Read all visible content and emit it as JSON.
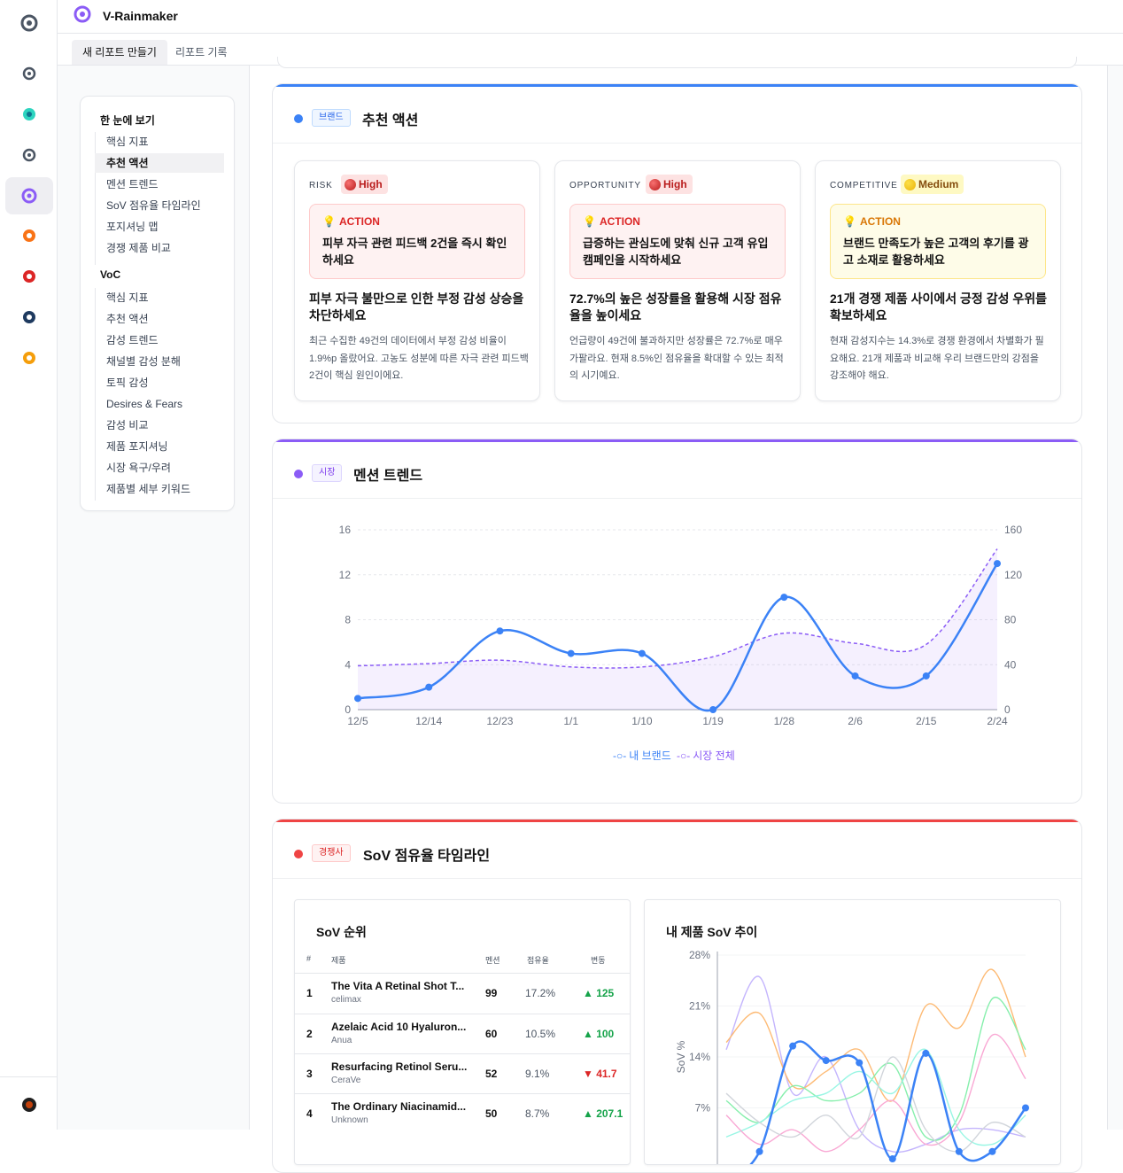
{
  "app": {
    "title": "V-Rainmaker"
  },
  "tabs": [
    {
      "label": "새 리포트 만들기"
    },
    {
      "label": "리포트 기록"
    }
  ],
  "rail": {
    "icons": [
      "rainmaker-gray-logo",
      "rainmaker-gray-logo",
      "teal-swirl-logo",
      "rainmaker-gray-logo",
      "rainmaker-purple-logo",
      "orange-heart-logo",
      "red-heart-logo",
      "navy-ring-logo",
      "orange-ring-logo"
    ],
    "avatar": "user-avatar"
  },
  "toc": {
    "group1": {
      "title": "한 눈에 보기",
      "items": [
        "핵심 지표",
        "추천 액션",
        "멘션 트렌드",
        "SoV 점유율 타임라인",
        "포지셔닝 맵",
        "경쟁 제품 비교"
      ]
    },
    "group2": {
      "title": "VoC",
      "items": [
        "핵심 지표",
        "추천 액션",
        "감성 트렌드",
        "채널별 감성 분해",
        "토픽 감성",
        "Desires & Fears",
        "감성 비교",
        "제품 포지셔닝",
        "시장 욕구/우려",
        "제품별 세부 키워드"
      ]
    },
    "selected": "추천 액션"
  },
  "actions_card": {
    "tag": "브랜드",
    "title": "추천 액션",
    "accent": "#3b82f6",
    "items": [
      {
        "type": "RISK",
        "level": "High",
        "action_label": "ACTION",
        "action": "피부 자극 관련 피드백 2건을 즉시 확인하세요",
        "headline": "피부 자극 불만으로 인한 부정 감성 상승을 차단하세요",
        "body": "최근 수집한 49건의 데이터에서 부정 감성 비율이 1.9%p 올랐어요. 고농도 성분에 따른 자극 관련 피드백 2건이 핵심 원인이에요."
      },
      {
        "type": "OPPORTUNITY",
        "level": "High",
        "action_label": "ACTION",
        "action": "급증하는 관심도에 맞춰 신규 고객 유입 캠페인을 시작하세요",
        "headline": "72.7%의 높은 성장률을 활용해 시장 점유율을 높이세요",
        "body": "언급량이 49건에 불과하지만 성장률은 72.7%로 매우 가팔라요. 현재 8.5%인 점유율을 확대할 수 있는 최적의 시기예요."
      },
      {
        "type": "COMPETITIVE",
        "level": "Medium",
        "action_label": "ACTION",
        "action": "브랜드 만족도가 높은 고객의 후기를 광고 소재로 활용하세요",
        "headline": "21개 경쟁 제품 사이에서 긍정 감성 우위를 확보하세요",
        "body": "현재 감성지수는 14.3%로 경쟁 환경에서 차별화가 필요해요. 21개 제품과 비교해 우리 브랜드만의 강점을 강조해야 해요."
      }
    ]
  },
  "mention_card": {
    "tag": "시장",
    "title": "멘션 트렌드",
    "accent": "#8b5cf6",
    "chart_data": {
      "type": "line",
      "categories": [
        "12/5",
        "12/14",
        "12/23",
        "1/1",
        "1/10",
        "1/19",
        "1/28",
        "2/6",
        "2/15",
        "2/24"
      ],
      "series": [
        {
          "name": "내 브랜드",
          "axis": "left",
          "values": [
            1,
            2,
            7,
            5,
            5,
            0,
            10,
            3,
            3,
            13
          ],
          "color": "#3b82f6"
        },
        {
          "name": "시장 전체",
          "axis": "right",
          "values": [
            39,
            41,
            44,
            38,
            38,
            47,
            68,
            59,
            58,
            143
          ],
          "color": "#8b5cf6"
        }
      ],
      "ylim_left": [
        0,
        16
      ],
      "yticks_left": [
        0,
        4,
        8,
        12,
        16
      ],
      "ylim_right": [
        0,
        160
      ],
      "yticks_right": [
        0,
        40,
        80,
        120,
        160
      ],
      "legend": "bottom"
    }
  },
  "sov_card": {
    "tag": "경쟁사",
    "title": "SoV 점유율 타임라인",
    "accent": "#ef4444",
    "ranking": {
      "title": "SoV 순위",
      "headers": [
        "#",
        "제품",
        "멘션",
        "점유율",
        "변동"
      ],
      "rows": [
        {
          "rank": "1",
          "product": "The Vita A Retinal Shot T...",
          "brand": "celimax",
          "mentions": "99",
          "share": "17.2%",
          "change": "▲ 125",
          "dir": "up"
        },
        {
          "rank": "2",
          "product": "Azelaic Acid 10 Hyaluron...",
          "brand": "Anua",
          "mentions": "60",
          "share": "10.5%",
          "change": "▲ 100",
          "dir": "up"
        },
        {
          "rank": "3",
          "product": "Resurfacing Retinol Seru...",
          "brand": "CeraVe",
          "mentions": "52",
          "share": "9.1%",
          "change": "▼ 41.7",
          "dir": "down"
        },
        {
          "rank": "4",
          "product": "The Ordinary Niacinamid...",
          "brand": "Unknown",
          "mentions": "50",
          "share": "8.7%",
          "change": "▲ 207.1",
          "dir": "up"
        }
      ]
    },
    "trend": {
      "title": "내 제품 SoV 추이",
      "chart_data": {
        "type": "line",
        "ylabel": "SoV %",
        "yticks": [
          "28%",
          "21%",
          "14%",
          "7%"
        ],
        "ylim": [
          0,
          28
        ],
        "highlight": {
          "values": [
            -3,
            1,
            15.5,
            13.5,
            13.2,
            0,
            14.5,
            1,
            1,
            7
          ],
          "color": "#3b82f6"
        },
        "background": [
          {
            "values": [
              15,
              25,
              9,
              14,
              4,
              1,
              2,
              4,
              4,
              3
            ],
            "color": "#c4b5fd"
          },
          {
            "values": [
              16,
              20,
              10,
              12,
              15,
              8,
              21,
              18,
              26,
              14
            ],
            "color": "#fdba74"
          },
          {
            "values": [
              8,
              5,
              10,
              8,
              9,
              13,
              3,
              6,
              22,
              15
            ],
            "color": "#86efac"
          },
          {
            "values": [
              3,
              5,
              8,
              9,
              12,
              9,
              15,
              4,
              2,
              6
            ],
            "color": "#99f6e4"
          },
          {
            "values": [
              6,
              2,
              4,
              1,
              4,
              8,
              2,
              5,
              17,
              11
            ],
            "color": "#f9a8d4"
          },
          {
            "values": [
              9,
              5,
              3,
              6,
              3,
              14,
              4,
              1,
              5,
              3
            ],
            "color": "#d1d5db"
          }
        ]
      }
    }
  }
}
